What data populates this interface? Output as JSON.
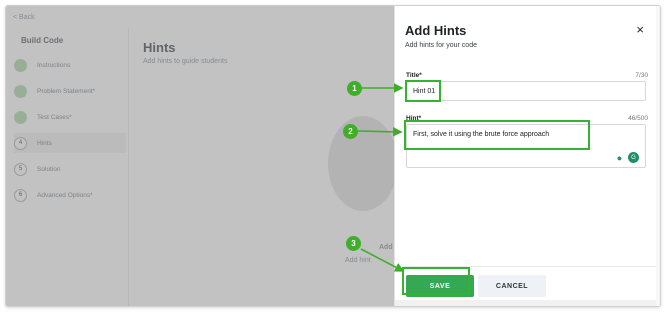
{
  "background": {
    "back_label": "< Back",
    "sidebar_title": "Build Code",
    "steps": [
      {
        "num": "",
        "label": "Instructions"
      },
      {
        "num": "",
        "label": "Problem Statement*"
      },
      {
        "num": "",
        "label": "Test Cases*"
      },
      {
        "num": "4",
        "label": "Hints"
      },
      {
        "num": "5",
        "label": "Solution"
      },
      {
        "num": "6",
        "label": "Advanced Options*"
      }
    ],
    "main_title": "Hints",
    "main_subtitle": "Add hints to guide students",
    "empty_title": "Add",
    "empty_subtitle": "Add hint"
  },
  "drawer": {
    "title": "Add Hints",
    "subtitle": "Add hints for your code",
    "close_glyph": "×",
    "title_field": {
      "label": "Title*",
      "counter": "7/30",
      "value": "Hint 01"
    },
    "hint_field": {
      "label": "Hint*",
      "counter": "46/500",
      "value": "First, solve it using the brute force approach"
    },
    "tool_icons": [
      "hint-bulb-icon",
      "grammarly-icon"
    ],
    "save_label": "SAVE",
    "cancel_label": "CANCEL"
  },
  "annotations": [
    "1",
    "2",
    "3"
  ],
  "colors": {
    "accent": "#34a853",
    "annotation": "#34b233",
    "overlay": "#6e6e6e"
  }
}
